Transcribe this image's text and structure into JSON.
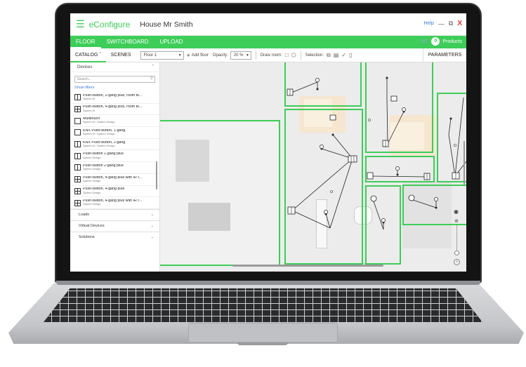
{
  "app": {
    "name": "eConfigure",
    "project": "House Mr Smith",
    "help": "Help",
    "menu_icon": "hamburger-icon"
  },
  "tabs": [
    "FLOOR",
    "SWITCHBOARD",
    "UPLOAD"
  ],
  "products": {
    "count": "0",
    "label": "Products"
  },
  "toolbar": {
    "catalog": "CATALOG",
    "scenes": "SCENES",
    "floor": "Floor 1",
    "add_floor": "Add floor",
    "opacity_label": "Opacity:",
    "opacity_value": "20 %",
    "draw_room": "Draw room:",
    "selection": "Selection:",
    "parameters": "PARAMETERS"
  },
  "sidebar": {
    "header": "Devices",
    "search_placeholder": "Search...",
    "show_filters": "Show filters",
    "items": [
      {
        "name": "Push-button, 2-gang plus, room te...",
        "sub": "System M",
        "icon": "split"
      },
      {
        "name": "Push-button, 4-gang plus, room te...",
        "sub": "System M",
        "icon": "quad"
      },
      {
        "name": "Multitouch",
        "sub": "System M / System Design",
        "icon": "plain"
      },
      {
        "name": "KNX Push-button, 1-gang",
        "sub": "System M / System Design",
        "icon": "plain"
      },
      {
        "name": "KNX Push-button, 2-gang",
        "sub": "System M / System Design",
        "icon": "split"
      },
      {
        "name": "Push-button 1-gang plus",
        "sub": "System Design",
        "icon": "split"
      },
      {
        "name": "Push-button 2-gang plus",
        "sub": "System Design",
        "icon": "split"
      },
      {
        "name": "Push-button, 4-gang plus with IR r...",
        "sub": "System Design",
        "icon": "quad"
      },
      {
        "name": "Push-button, 4-gang plus",
        "sub": "System Design",
        "icon": "quad"
      },
      {
        "name": "Push-button, 4-gang plus with IR r...",
        "sub": "System Design",
        "icon": "quad"
      }
    ],
    "sections": [
      "Loads",
      "Virtual Devices",
      "Solutions"
    ]
  },
  "colors": {
    "accent": "#3dcd58",
    "close": "#e03a2f",
    "link": "#3d7bd9"
  }
}
